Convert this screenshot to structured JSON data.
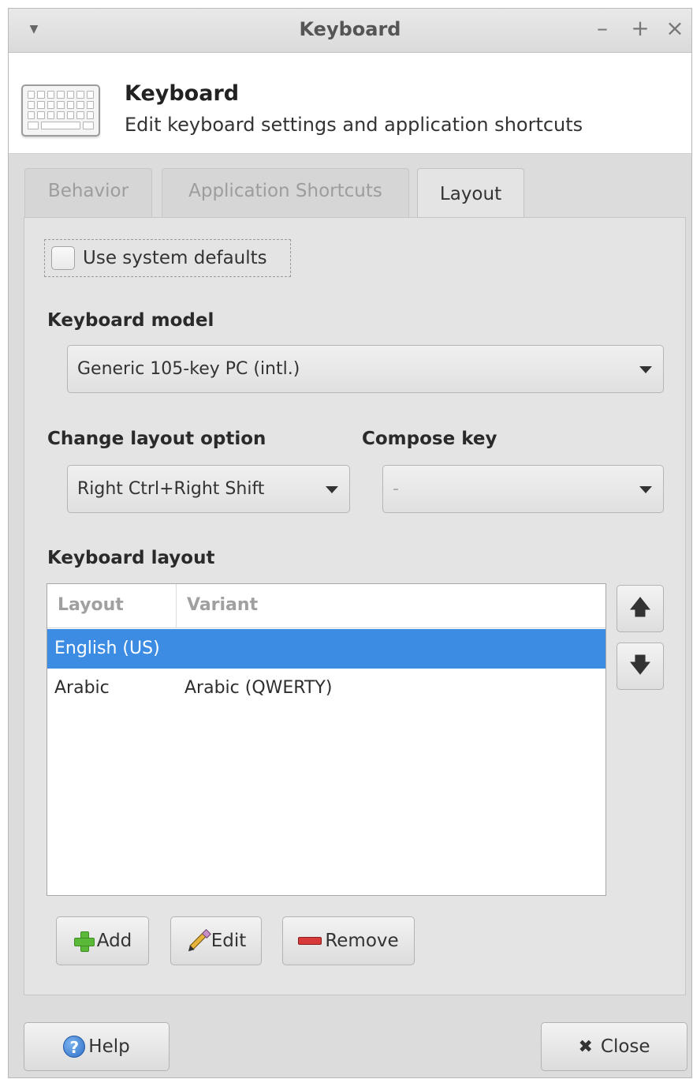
{
  "window": {
    "title": "Keyboard",
    "controls": {
      "minimize": "–",
      "maximize": "+",
      "close": "×"
    }
  },
  "header": {
    "icon": "keyboard-icon",
    "title": "Keyboard",
    "subtitle": "Edit keyboard settings and application shortcuts"
  },
  "tabs": [
    {
      "label": "Behavior",
      "active": false
    },
    {
      "label": "Application Shortcuts",
      "active": false
    },
    {
      "label": "Layout",
      "active": true
    }
  ],
  "layout_tab": {
    "use_system_defaults": {
      "label": "Use system defaults",
      "checked": false
    },
    "keyboard_model": {
      "label": "Keyboard model",
      "value": "Generic 105-key PC (intl.)"
    },
    "change_layout_option": {
      "label": "Change layout option",
      "value": "Right Ctrl+Right Shift"
    },
    "compose_key": {
      "label": "Compose key",
      "value": "-"
    },
    "keyboard_layout": {
      "label": "Keyboard layout",
      "columns": [
        "Layout",
        "Variant"
      ],
      "rows": [
        {
          "layout": "English (US)",
          "variant": "",
          "selected": true
        },
        {
          "layout": "Arabic",
          "variant": "Arabic (QWERTY)",
          "selected": false
        }
      ],
      "move_up_icon": "arrow-up-icon",
      "move_down_icon": "arrow-down-icon"
    },
    "buttons": {
      "add": "Add",
      "edit": "Edit",
      "remove": "Remove"
    }
  },
  "footer": {
    "help": "Help",
    "close": "Close"
  },
  "colors": {
    "selection": "#3c8ce4",
    "window_bg": "#dcdcdc",
    "panel_bg": "#e4e4e4"
  }
}
